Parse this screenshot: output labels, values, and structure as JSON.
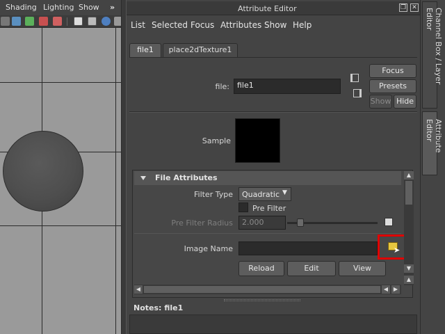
{
  "viewport": {
    "menus": [
      "Shading",
      "Lighting",
      "Show"
    ],
    "overflow": "»"
  },
  "editor": {
    "title": "Attribute Editor",
    "menus": [
      "List",
      "Selected",
      "Focus",
      "Attributes",
      "Show",
      "Help"
    ],
    "tabs": [
      "file1",
      "place2dTexture1"
    ],
    "node_label": "file:",
    "node_value": "file1",
    "buttons": {
      "focus": "Focus",
      "presets": "Presets",
      "show": "Show",
      "hide": "Hide"
    },
    "sample_label": "Sample",
    "section": {
      "title": "File Attributes",
      "filter_type_label": "Filter Type",
      "filter_type_value": "Quadratic",
      "pre_filter_label": "Pre Filter",
      "pre_filter_radius_label": "Pre Filter Radius",
      "pre_filter_radius_value": "2.000",
      "image_name_label": "Image Name",
      "image_name_value": "",
      "reload": "Reload",
      "edit": "Edit",
      "view": "View"
    },
    "notes_label": "Notes:  file1"
  },
  "side_tabs": [
    "Channel Box / Layer Editor",
    "Attribute Editor"
  ],
  "colors": {
    "highlight": "#e00000",
    "folder": "#e8c840"
  }
}
